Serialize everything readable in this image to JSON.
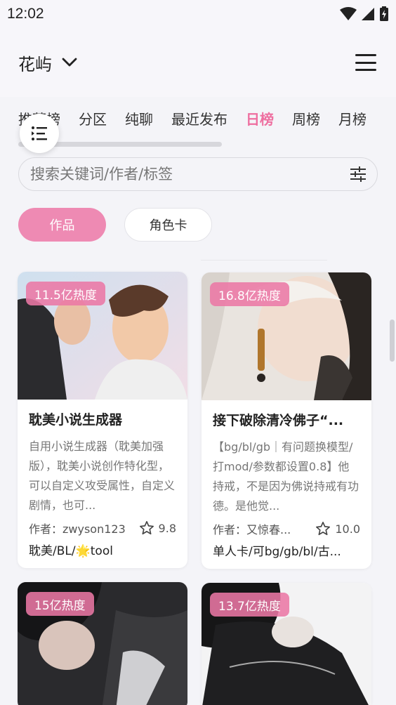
{
  "status": {
    "time": "12:02"
  },
  "header": {
    "title": "花屿"
  },
  "tabs": [
    {
      "label": "推荐榜",
      "active": false
    },
    {
      "label": "分区",
      "active": false
    },
    {
      "label": "纯聊",
      "active": false
    },
    {
      "label": "最近发布",
      "active": false
    },
    {
      "label": "日榜",
      "active": true
    },
    {
      "label": "周榜",
      "active": false
    },
    {
      "label": "月榜",
      "active": false
    }
  ],
  "search": {
    "placeholder": "搜索关键词/作者/标签"
  },
  "type_toggle": {
    "works": "作品",
    "character_card": "角色卡"
  },
  "cards": [
    {
      "heat": "11.5亿热度",
      "title": "耽美小说生成器",
      "desc": "自用小说生成器（耽美加强版），耽美小说创作特化型，可以自定义攻受属性，自定义剧情，也可...",
      "author": "作者：zwyson123",
      "rating": "9.8",
      "tags": "耽美/BL/🌟tool"
    },
    {
      "heat": "16.8亿热度",
      "title": "接下破除清冷佛子“...",
      "desc": "【bg/bl/gb｜有问题换模型/打mod/参数都设置0.8】他持戒，不是因为佛说持戒有功德。是他觉...",
      "author": "作者：又惊春...",
      "rating": "10.0",
      "tags": "单人卡/可bg/gb/bl/古..."
    },
    {
      "heat": "15亿热度"
    },
    {
      "heat": "13.7亿热度"
    }
  ],
  "colors": {
    "accent": "#ee6fa0",
    "badge": "#eb78a5"
  }
}
